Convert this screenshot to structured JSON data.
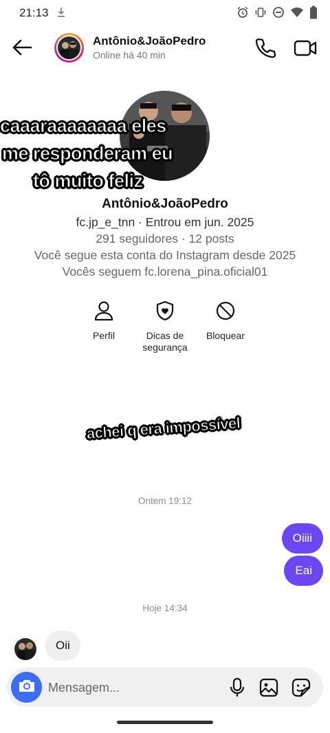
{
  "status_bar": {
    "time": "21:13",
    "icons": [
      "download-icon",
      "alarm-icon",
      "vibrate-icon",
      "do-not-disturb-icon",
      "wifi-icon",
      "battery-icon"
    ]
  },
  "header": {
    "name": "Antônio&JoãoPedro",
    "status": "Online há 40 min",
    "icons": [
      "back-arrow-icon",
      "phone-icon",
      "video-camera-icon"
    ]
  },
  "profile": {
    "name": "Antônio&JoãoPedro",
    "handle_joined": "fc.jp_e_tnn · Entrou em jun. 2025",
    "stats": "291 seguidores · 12 posts",
    "following_since": "Você segue esta conta do Instagram desde 2025",
    "mutual": "Vocês seguem fc.lorena_pina.oficial01"
  },
  "stickers": {
    "line1": "caaaraaaaaaaa eles",
    "line2": "me responderam eu",
    "line3": "tô muito feliz",
    "overlay2": "achei q era impossível"
  },
  "actions": [
    {
      "label": "Perfil",
      "icon": "person-icon"
    },
    {
      "label": "Dicas de\nsegurança",
      "icon": "shield-heart-icon"
    },
    {
      "label": "Bloquear",
      "icon": "block-icon"
    }
  ],
  "messages": {
    "timestamp_1": "Ontem 19:12",
    "sent_1": "Oiiii",
    "sent_2": "Eai",
    "timestamp_2": "Hoje 14:34",
    "received_1": "Oii"
  },
  "composer": {
    "placeholder": "Mensagem..."
  },
  "colors": {
    "sent_bubble": "#6b46f3",
    "received_bubble": "#efefef",
    "camera_button": "#3d6df2"
  }
}
